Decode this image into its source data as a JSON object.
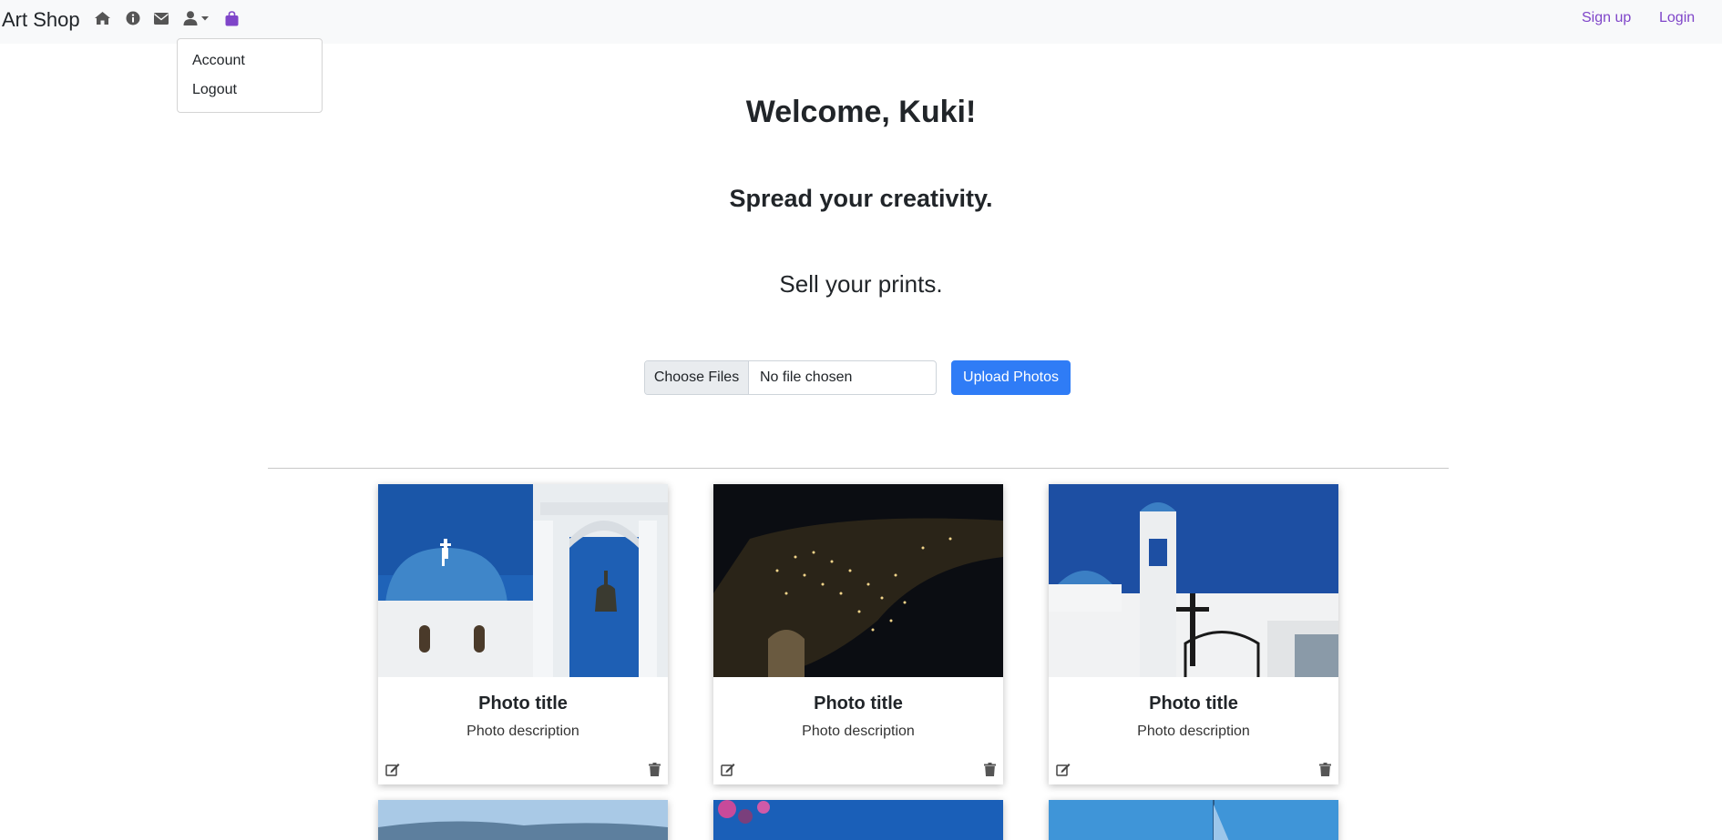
{
  "navbar": {
    "brand": "Art Shop",
    "icons": [
      "home-icon",
      "info-icon",
      "envelope-icon",
      "user-icon",
      "shopping-bag-icon"
    ],
    "signup_label": "Sign up",
    "login_label": "Login"
  },
  "dropdown": {
    "items": [
      {
        "label": "Account"
      },
      {
        "label": "Logout"
      }
    ]
  },
  "hero": {
    "welcome": "Welcome, Kuki!",
    "tagline": "Spread your creativity.",
    "subtitle": "Sell your prints."
  },
  "upload": {
    "choose_label": "Choose Files",
    "status": "No file chosen",
    "button_label": "Upload Photos"
  },
  "photos": [
    {
      "title": "Photo title",
      "description": "Photo description"
    },
    {
      "title": "Photo title",
      "description": "Photo description"
    },
    {
      "title": "Photo title",
      "description": "Photo description"
    }
  ],
  "colors": {
    "accent": "#7f45c9",
    "primary_button": "#2f7cf6",
    "navbar_bg": "#f8f9fa"
  }
}
